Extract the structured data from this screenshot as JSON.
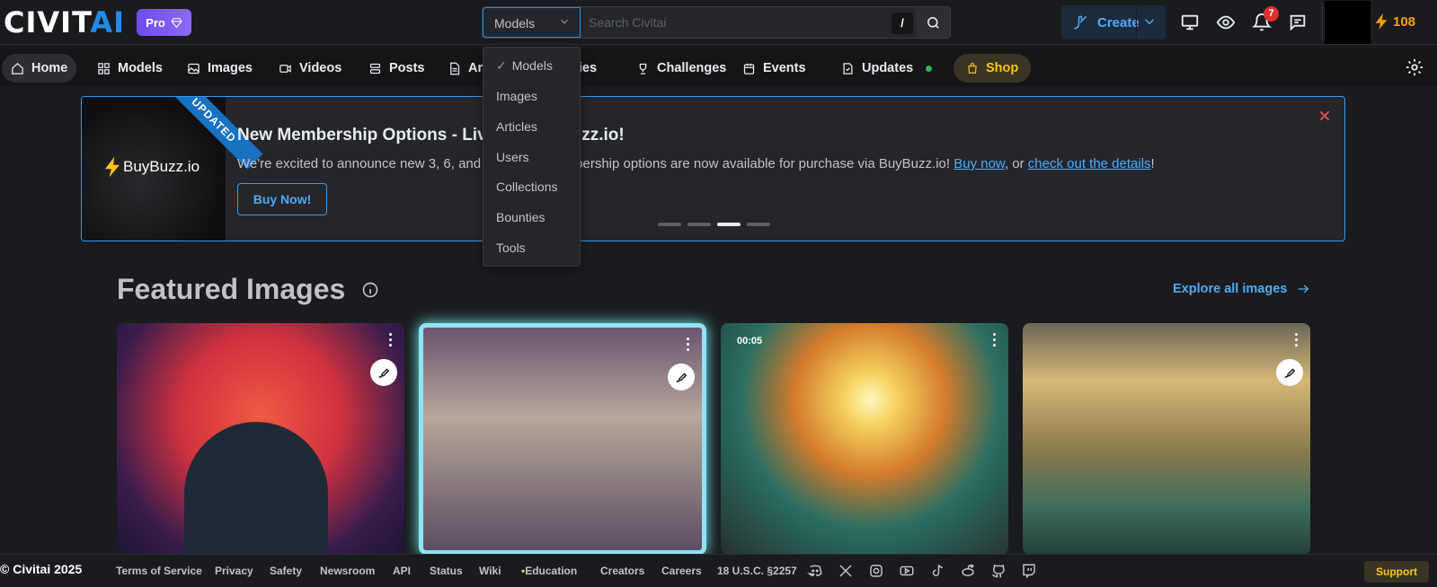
{
  "header": {
    "logo_main": "CIVIT",
    "logo_accent": "AI",
    "pro_label": "Pro",
    "search_scope": "Models",
    "search_placeholder": "Search Civitai",
    "search_shortcut": "/",
    "create_label": "Create",
    "notification_count": "7",
    "buzz_amount": "108"
  },
  "nav": {
    "items": [
      {
        "label": "Home",
        "icon": "home-icon"
      },
      {
        "label": "Models",
        "icon": "grid-icon"
      },
      {
        "label": "Images",
        "icon": "photo-icon"
      },
      {
        "label": "Videos",
        "icon": "video-icon"
      },
      {
        "label": "Posts",
        "icon": "stack-icon"
      },
      {
        "label": "Articles",
        "icon": "article-icon"
      },
      {
        "label": "Bounties",
        "icon": "bounty-icon"
      },
      {
        "label": "Challenges",
        "icon": "trophy-icon"
      },
      {
        "label": "Events",
        "icon": "calendar-icon"
      },
      {
        "label": "Updates",
        "icon": "updates-icon"
      },
      {
        "label": "Shop",
        "icon": "shopping-bag-icon"
      }
    ]
  },
  "dropdown": {
    "items": [
      "Models",
      "Images",
      "Articles",
      "Users",
      "Collections",
      "Bounties",
      "Tools"
    ]
  },
  "banner": {
    "ribbon": "UPDATED",
    "brand": "BuyBuzz.io",
    "title": "New Membership Options - Live on BuyBuzz.io!",
    "text_before": "We're excited to announce new 3, 6, and 12-month membership options are now available for purchase via BuyBuzz.io! ",
    "link_buy": "Buy now",
    "text_mid": ", or ",
    "link_details": "check out the details",
    "text_end": "!",
    "button": "Buy Now!"
  },
  "featured": {
    "title": "Featured Images",
    "explore": "Explore all images",
    "video_duration": "00:05"
  },
  "footer": {
    "copyright": "© Civitai 2025",
    "links": [
      "Terms of Service",
      "Privacy",
      "Safety",
      "Newsroom",
      "API",
      "Status",
      "Wiki",
      "Education",
      "Creators",
      "Careers",
      "18 U.S.C. §2257"
    ],
    "support": "Support"
  },
  "colors": {
    "accent": "#228be6",
    "link": "#4dabf7",
    "buzz": "#f59f00",
    "badge": "#e03131"
  }
}
